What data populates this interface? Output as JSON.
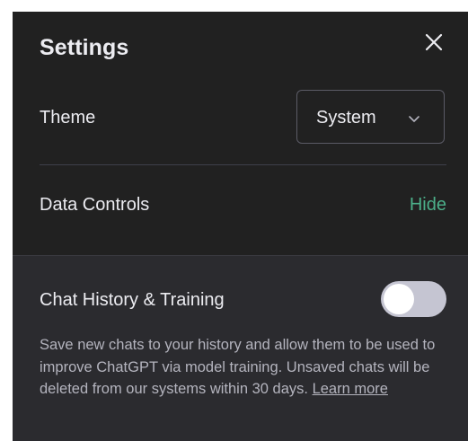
{
  "settings": {
    "title": "Settings",
    "close_icon": "close-icon"
  },
  "theme": {
    "label": "Theme",
    "selected": "System",
    "chevron_icon": "chevron-down-icon"
  },
  "data_controls": {
    "label": "Data Controls",
    "toggle_label": "Hide"
  },
  "chat_history": {
    "label": "Chat History & Training",
    "toggle_state": "off",
    "description": "Save new chats to your history and allow them to be used to improve ChatGPT via model training. Unsaved chats will be deleted from our systems within 30 days.",
    "learn_more": "Learn more"
  },
  "colors": {
    "panel_bg": "#212121",
    "lower_panel_bg": "#2b2b2f",
    "text_primary": "#ececf1",
    "text_secondary": "#b4b4be",
    "accent_green": "#4cb08a",
    "toggle_track": "#c5c5d2"
  }
}
